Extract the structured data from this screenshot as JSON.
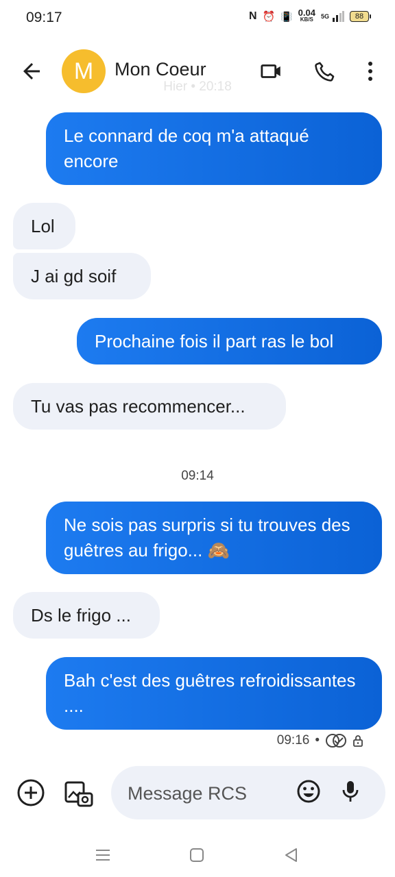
{
  "status_bar": {
    "time": "09:17",
    "net_speed": "0.04",
    "net_unit": "KB/S",
    "network": "5G",
    "battery": "88"
  },
  "header": {
    "avatar_letter": "M",
    "contact_name": "Mon Coeur",
    "faded_timestamp": "Hier • 20:18",
    "icons": [
      "back-arrow-icon",
      "video-call-icon",
      "phone-icon",
      "more-vert-icon"
    ]
  },
  "messages": [
    {
      "dir": "out",
      "text": "Le connard de coq m'a attaqué encore"
    },
    {
      "dir": "in",
      "text": "Lol"
    },
    {
      "dir": "in",
      "text": "J ai gd soif"
    },
    {
      "dir": "out",
      "text": "Prochaine fois il part ras le bol"
    },
    {
      "dir": "in",
      "text": "Tu vas pas recommencer..."
    },
    {
      "dir": "out",
      "text": "Ne sois pas surpris si tu trouves des guêtres au frigo... 🙈"
    },
    {
      "dir": "in",
      "text": "Ds le frigo ..."
    },
    {
      "dir": "out",
      "text": "Bah c'est des guêtres refroidissantes ...."
    }
  ],
  "separator_time": "09:14",
  "last_meta": {
    "time": "09:16",
    "dot": "•"
  },
  "composer": {
    "placeholder": "Message RCS"
  },
  "colors": {
    "outgoing": "#0b62d6",
    "incoming": "#eef1f8",
    "avatar": "#f6bd2d"
  }
}
